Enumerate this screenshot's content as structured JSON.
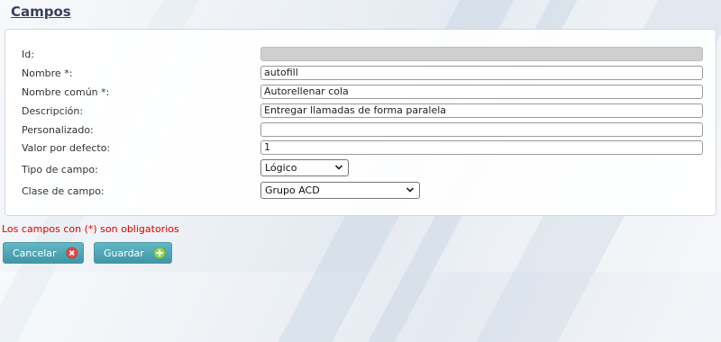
{
  "title": "Campos",
  "form": {
    "id": {
      "label": "Id:",
      "value": ""
    },
    "nombre": {
      "label": "Nombre *:",
      "value": "autofill"
    },
    "nombre_comun": {
      "label": "Nombre común *:",
      "value": "Autorellenar cola"
    },
    "descripcion": {
      "label": "Descripción:",
      "value": "Entregar llamadas de forma paralela"
    },
    "personalizado": {
      "label": "Personalizado:",
      "value": ""
    },
    "valor_defecto": {
      "label": "Valor por defecto:",
      "value": "1"
    },
    "tipo_campo": {
      "label": "Tipo de campo:",
      "selected": "Lógico"
    },
    "clase_campo": {
      "label": "Clase de campo:",
      "selected": "Grupo ACD"
    }
  },
  "required_note": "Los campos con (*) son obligatorios",
  "buttons": {
    "cancel": {
      "label": "Cancelar",
      "icon": "close-circle-icon"
    },
    "save": {
      "label": "Guardar",
      "icon": "plus-circle-icon"
    }
  },
  "colors": {
    "button_bg": "#4fa7b6",
    "required_text": "#e00000",
    "title": "#3b3f5c",
    "cancel_icon": "#e24a4a",
    "save_icon": "#7fcf4a"
  }
}
